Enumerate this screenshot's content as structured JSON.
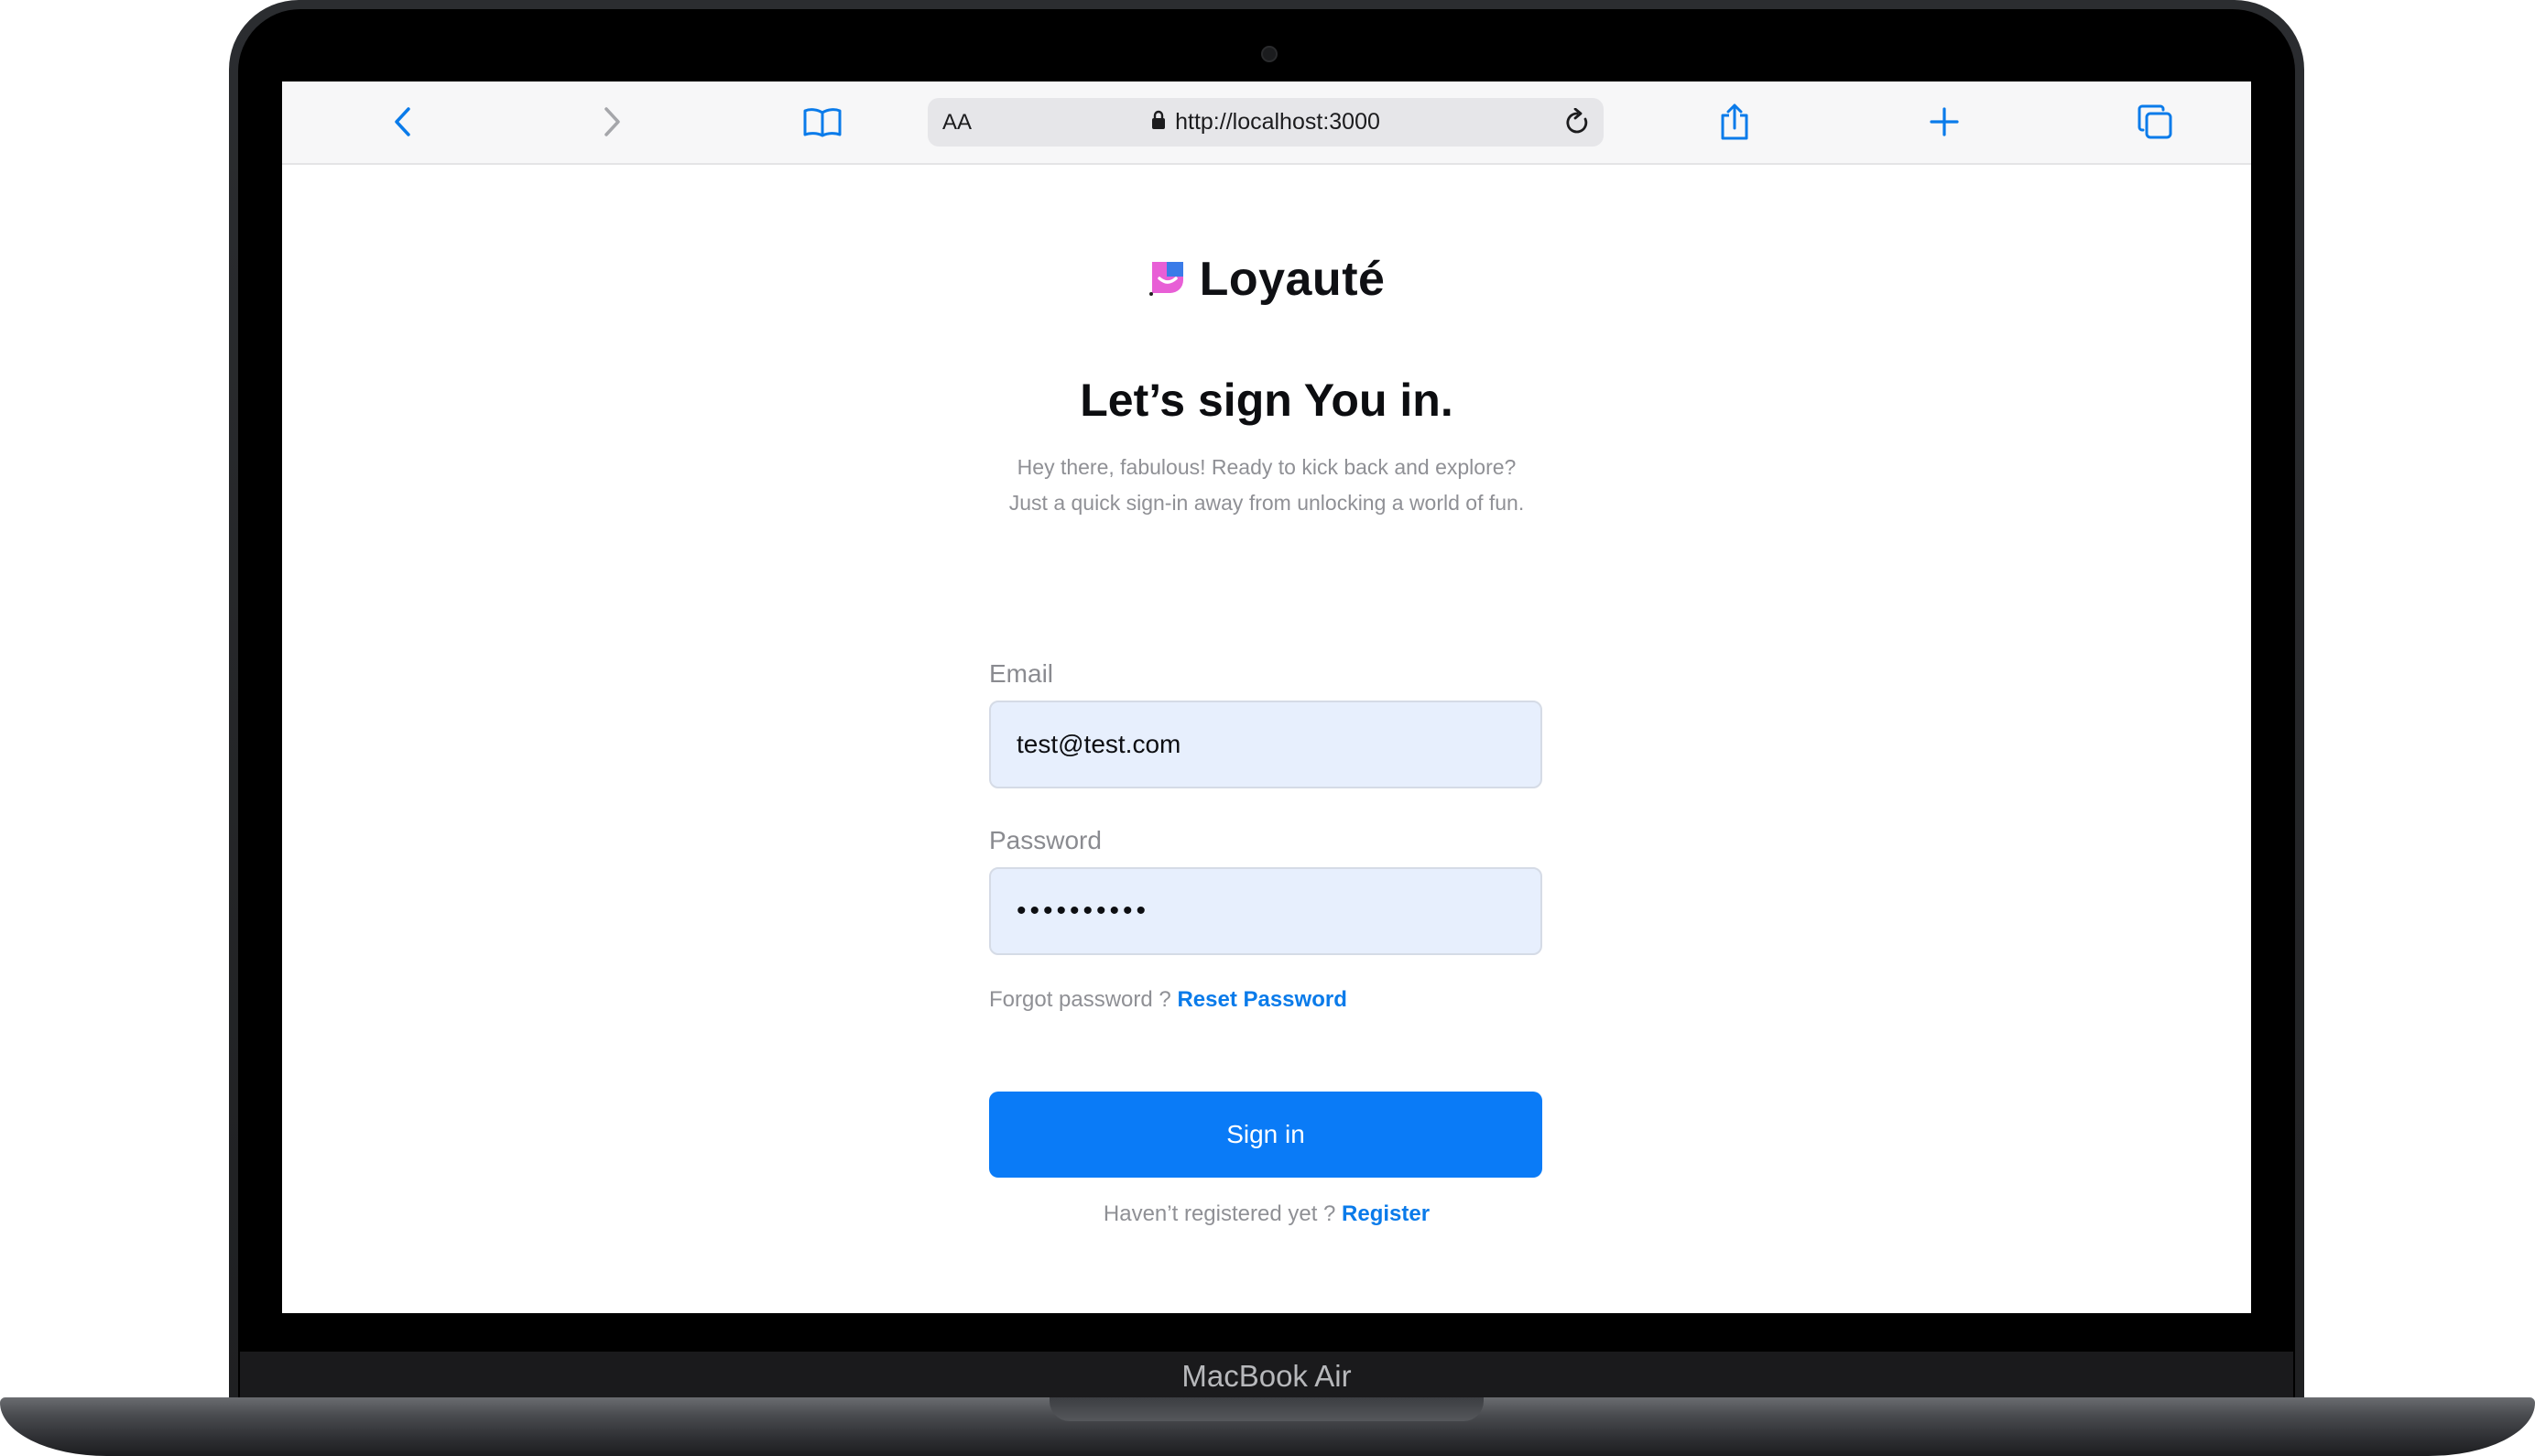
{
  "device": {
    "model_label": "MacBook Air"
  },
  "browser": {
    "text_size_label": "AA",
    "url": "http://localhost:3000",
    "accent_color": "#0a7bea"
  },
  "app": {
    "brand_name": "Loyauté",
    "heading": "Let’s sign You in.",
    "subtitle_line1": "Hey there, fabulous! Ready to kick back and explore?",
    "subtitle_line2": "Just a quick sign-in away from unlocking a world of fun.",
    "email_label": "Email",
    "email_value": "test@test.com",
    "password_label": "Password",
    "password_value": "••••••••••",
    "forgot_text": "Forgot password ?",
    "reset_link": "Reset Password",
    "signin_button": "Sign in",
    "register_text": "Haven’t registered yet ?",
    "register_link": "Register",
    "primary_color": "#0a7bf7",
    "input_bg_color": "#e7effd"
  }
}
